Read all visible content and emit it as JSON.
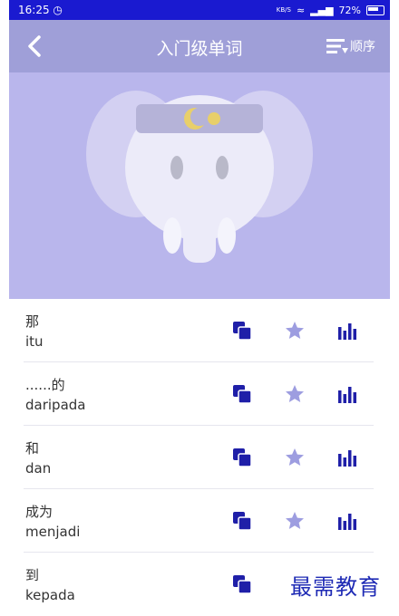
{
  "status": {
    "time": "16:25",
    "net_unit": "KB/S",
    "battery": "72%"
  },
  "header": {
    "title": "入门级单词",
    "order_label": "顺序"
  },
  "colors": {
    "status_bar": "#1a1ad0",
    "app_bar": "#9f9fd8",
    "banner": "#b9b6ec",
    "icon_dark": "#1f1fa8",
    "icon_star": "#9d9de0"
  },
  "words": [
    {
      "cn": "那",
      "ms": "itu"
    },
    {
      "cn": "......的",
      "ms": "daripada"
    },
    {
      "cn": "和",
      "ms": "dan"
    },
    {
      "cn": "成为",
      "ms": "menjadi"
    },
    {
      "cn": "到",
      "ms": "kepada"
    }
  ],
  "icons": {
    "copy": "copy-icon",
    "star": "star-icon",
    "stats": "bar-chart-icon"
  },
  "watermark": "最需教育"
}
